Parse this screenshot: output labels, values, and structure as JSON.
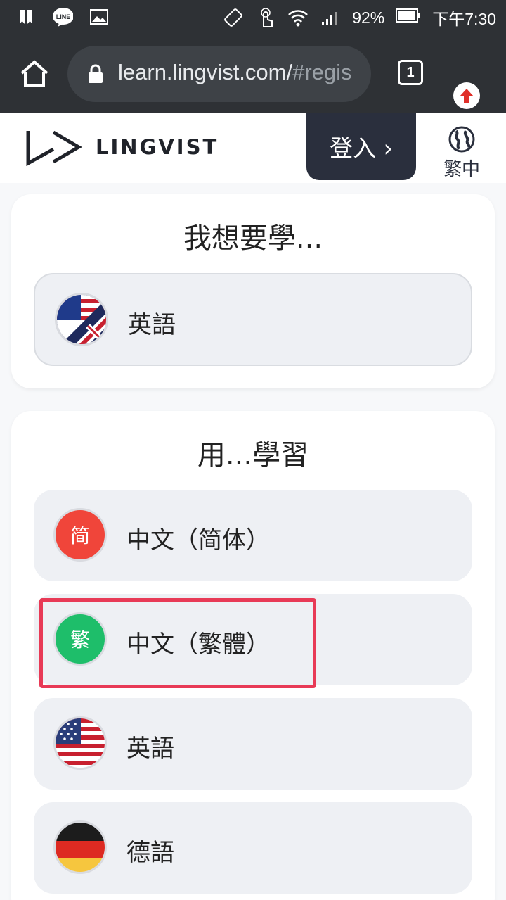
{
  "status_bar": {
    "battery": "92%",
    "time": "下午7:30"
  },
  "browser": {
    "url_host": "learn.lingvist.com/",
    "url_rest": "#regis",
    "tab_count": "1"
  },
  "header": {
    "logo_text": "LINGVIST",
    "login_label": "登入 ›",
    "lang_label": "繁中"
  },
  "learn_card": {
    "title": "我想要學...",
    "selected": "英語"
  },
  "from_card": {
    "title": "用...學習",
    "options": [
      {
        "label": "中文（简体）",
        "badge": "简",
        "color": "#f0453a"
      },
      {
        "label": "中文（繁體）",
        "badge": "繁",
        "color": "#1ebe6a"
      },
      {
        "label": "英語",
        "icon": "us-flag-icon"
      },
      {
        "label": "德語",
        "icon": "de-flag-icon"
      }
    ]
  },
  "colors": {
    "highlight": "#e83a56",
    "header_dark": "#2a2f3d"
  }
}
